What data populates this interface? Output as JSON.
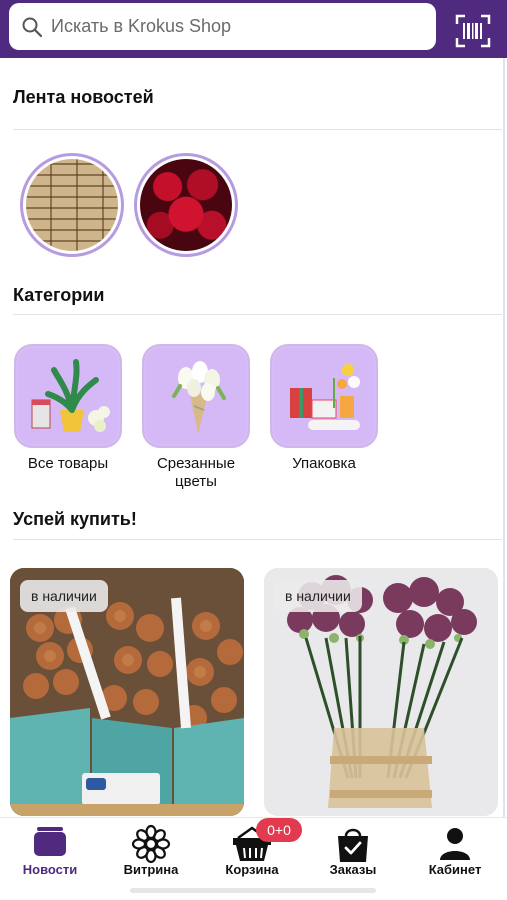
{
  "search": {
    "placeholder": "Искать в Krokus Shop"
  },
  "sections": {
    "news_feed": "Лента новостей",
    "categories": "Категории",
    "hurry_buy": "Успей купить!"
  },
  "categories": [
    {
      "label_line1": "Все товары",
      "label_line2": ""
    },
    {
      "label_line1": "Срезанные",
      "label_line2": "цветы"
    },
    {
      "label_line1": "Упаковка",
      "label_line2": ""
    }
  ],
  "products": [
    {
      "badge": "в наличии"
    },
    {
      "badge": "в наличии"
    }
  ],
  "nav": [
    {
      "label": "Новости",
      "icon": "news-icon",
      "active": true
    },
    {
      "label": "Витрина",
      "icon": "flower-icon"
    },
    {
      "label": "Корзина",
      "icon": "basket-icon"
    },
    {
      "label": "Заказы",
      "icon": "orders-bag-icon"
    },
    {
      "label": "Кабинет",
      "icon": "person-icon"
    }
  ],
  "cart_badge": "0+0",
  "colors": {
    "brand": "#4f2a7f",
    "tile": "#d7bdf7",
    "badge": "#e23a4e"
  }
}
